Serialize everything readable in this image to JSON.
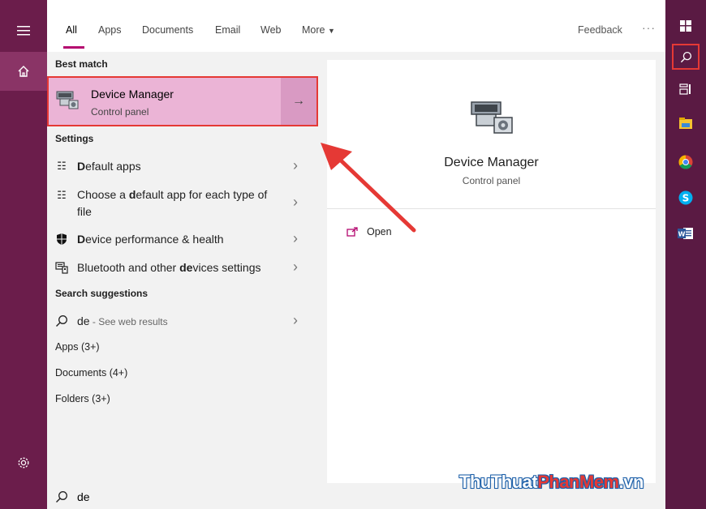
{
  "tabs": {
    "items": [
      "All",
      "Apps",
      "Documents",
      "Email",
      "Web",
      "More"
    ],
    "feedback": "Feedback",
    "more_options": "···"
  },
  "results": {
    "best_match_heading": "Best match",
    "best_match": {
      "title": "Device Manager",
      "subtitle": "Control panel"
    },
    "settings_heading": "Settings",
    "settings": [
      {
        "pre": "",
        "bold": "D",
        "post": "efault apps"
      },
      {
        "pre": "Choose a ",
        "bold": "d",
        "post": "efault app for each type of file"
      },
      {
        "pre": "",
        "bold": "D",
        "post": "evice performance & health"
      },
      {
        "pre": "Bluetooth and other ",
        "bold": "de",
        "post": "vices settings"
      }
    ],
    "suggestions_heading": "Search suggestions",
    "suggestion": {
      "query": "de",
      "note": " - See web results"
    },
    "categories": [
      "Apps (3+)",
      "Documents (4+)",
      "Folders (3+)"
    ]
  },
  "detail": {
    "title": "Device Manager",
    "subtitle": "Control panel",
    "open_label": "Open"
  },
  "search": {
    "query": "de"
  },
  "watermark": {
    "part1": "ThuThuat",
    "part2": "PhanMem",
    "part3": ".vn"
  },
  "colors": {
    "rail": "#6b1d4b",
    "taskbar": "#5a1a43",
    "selection": "#ebb4d6",
    "accent": "#b4086f",
    "highlight": "#e53935"
  },
  "icons": [
    "hamburger-icon",
    "home-icon",
    "settings-gear-icon",
    "windows-logo-icon",
    "search-icon",
    "task-view-icon",
    "file-explorer-icon",
    "chrome-icon",
    "skype-icon",
    "word-icon",
    "device-manager-icon",
    "default-apps-icon",
    "shield-icon",
    "bluetooth-devices-icon",
    "open-icon",
    "chevron-right-icon",
    "arrow-right-icon"
  ]
}
